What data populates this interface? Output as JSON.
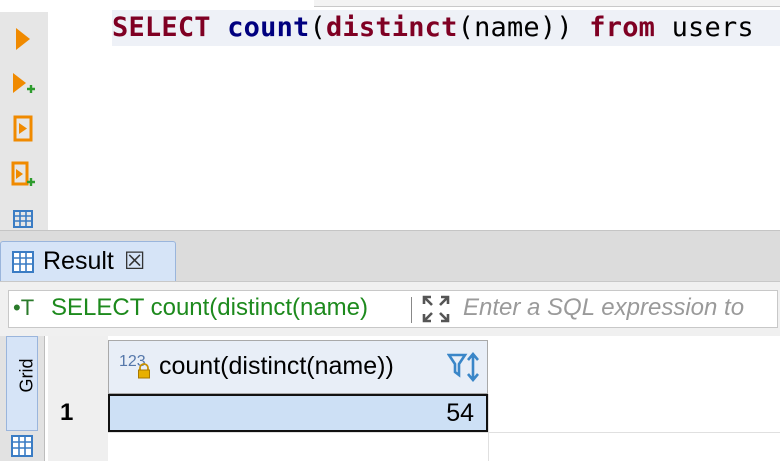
{
  "editor": {
    "sql": {
      "kw_select": "SELECT",
      "fn_count": "count",
      "paren_open": "(",
      "fn_distinct": "distinct",
      "arg": "(name))",
      "kw_from": "from",
      "table": "users"
    },
    "gutter_icons": [
      "execute-statement-icon",
      "execute-in-new-tab-icon",
      "execute-script-icon",
      "execute-script-new-tab-icon",
      "explain-plan-icon"
    ]
  },
  "results": {
    "tab_label": "Result",
    "tab_close_glyph": "☒",
    "filter": {
      "type_glyph": "•T",
      "query": "SELECT count(distinct(name)",
      "placeholder": "Enter a SQL expression to"
    },
    "vertical_tab_label": "Grid",
    "column": {
      "type_badge": "123",
      "name": "count(distinct(name))"
    },
    "rows": [
      {
        "num": "1",
        "value": "54"
      }
    ]
  },
  "colors": {
    "keyword": "#7f0023",
    "function": "#00007f",
    "filter_text": "#1d8a1d",
    "selected_cell": "#cde0f5",
    "accent_orange": "#f08a00"
  }
}
